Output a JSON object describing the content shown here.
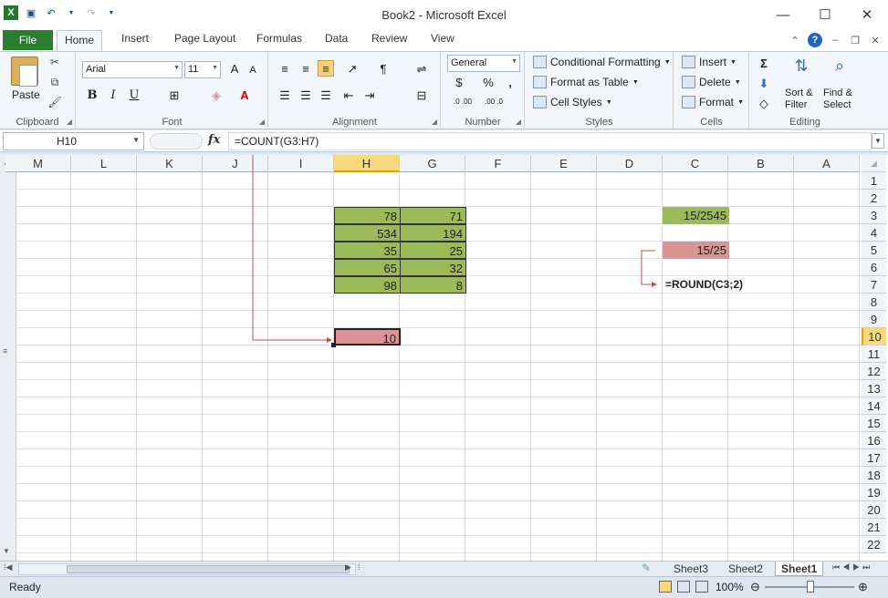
{
  "window": {
    "title": "Book2 - Microsoft Excel"
  },
  "qat": {
    "icons": [
      "excel-icon",
      "save-icon",
      "undo-icon",
      "redo-icon",
      "customize-icon"
    ]
  },
  "tabs": {
    "file": "File",
    "home": "Home",
    "insert": "Insert",
    "page_layout": "Page Layout",
    "formulas": "Formulas",
    "data": "Data",
    "review": "Review",
    "view": "View"
  },
  "ribbon": {
    "clipboard": {
      "label": "Clipboard",
      "paste": "Paste"
    },
    "font": {
      "label": "Font",
      "name": "Arial",
      "size": "11",
      "bold": "B",
      "italic": "I",
      "underline": "U"
    },
    "alignment": {
      "label": "Alignment"
    },
    "number": {
      "label": "Number",
      "format": "General",
      "percent": "%",
      "comma": ",",
      "inc_dec": ".0 .00",
      "dec_dec": ".00 .0"
    },
    "styles": {
      "label": "Styles",
      "cond": "Conditional Formatting",
      "table": "Format as Table",
      "cell_styles": "Cell Styles"
    },
    "cells": {
      "label": "Cells",
      "insert": "Insert",
      "delete": "Delete",
      "format": "Format"
    },
    "editing": {
      "label": "Editing",
      "sort1": "Sort &",
      "sort2": "Filter",
      "find1": "Find &",
      "find2": "Select"
    }
  },
  "formula_bar": {
    "name_box": "H10",
    "fx": "fx",
    "formula": "=COUNT(G3:H7)"
  },
  "grid": {
    "columns": [
      "M",
      "L",
      "K",
      "J",
      "I",
      "H",
      "G",
      "F",
      "E",
      "D",
      "C",
      "B",
      "A"
    ],
    "rows": [
      "1",
      "2",
      "3",
      "4",
      "5",
      "6",
      "7",
      "8",
      "9",
      "10",
      "11",
      "12",
      "13",
      "14",
      "15",
      "16",
      "17",
      "18",
      "19",
      "20",
      "21",
      "22"
    ],
    "selected_column": "H",
    "selected_row": "10",
    "cells": {
      "H3": "78",
      "G3": "71",
      "H4": "534",
      "G4": "194",
      "H5": "35",
      "G5": "25",
      "H6": "65",
      "G6": "32",
      "H7": "98",
      "G7": "8",
      "H10": "10",
      "C3": "15/2545",
      "C5": "15/25",
      "C7": "=ROUND(C3;2)"
    },
    "colors": {
      "green": "#9bbb59",
      "pink": "#d99594",
      "arrow": "#c0504d"
    }
  },
  "sheets": {
    "tabs": [
      "Sheet3",
      "Sheet2",
      "Sheet1"
    ],
    "active": "Sheet1"
  },
  "status": {
    "ready": "Ready",
    "zoom": "100%"
  }
}
